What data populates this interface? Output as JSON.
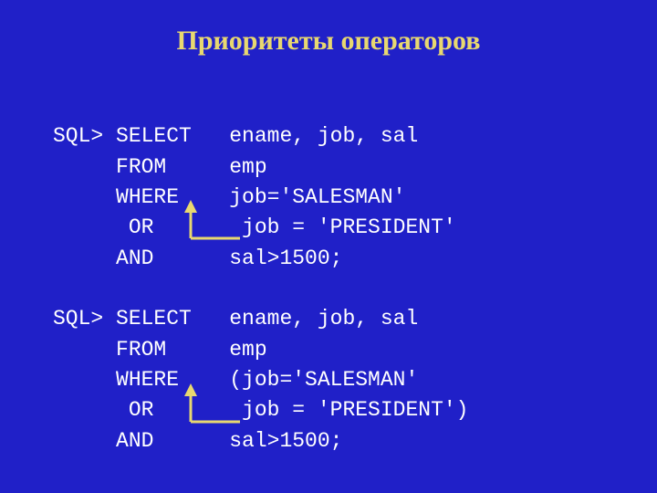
{
  "title": "Приоритеты операторов",
  "code": {
    "line1": "SQL> SELECT   ename, job, sal",
    "line2": "     FROM     emp",
    "line3": "     WHERE    job='SALESMAN'",
    "line4": "      OR       job = 'PRESIDENT'",
    "line5": "     AND      sal>1500;",
    "blank1": "",
    "line6": "SQL> SELECT   ename, job, sal",
    "line7": "     FROM     emp",
    "line8": "     WHERE    (job='SALESMAN'",
    "line9": "      OR       job = 'PRESIDENT')",
    "line10": "     AND      sal>1500;"
  }
}
